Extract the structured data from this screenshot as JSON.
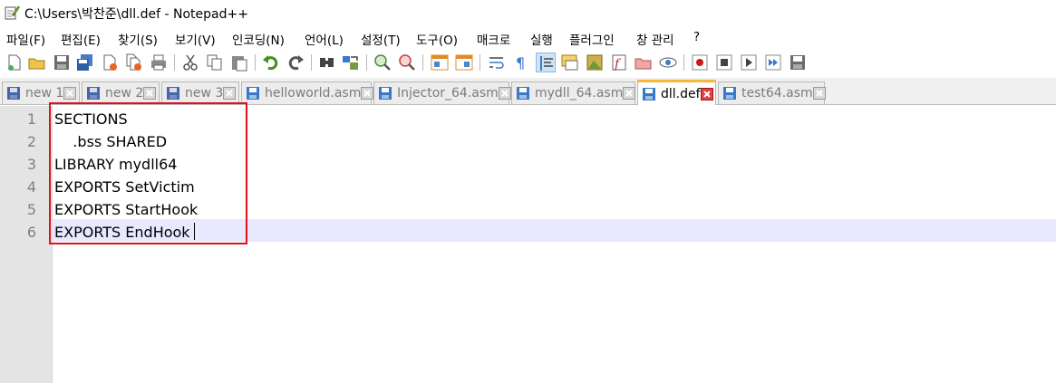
{
  "window": {
    "title": "C:\\Users\\박찬준\\dll.def - Notepad++",
    "icon": "notepadpp-icon"
  },
  "menu": {
    "items": [
      "파일(F)",
      "편집(E)",
      "찾기(S)",
      "보기(V)",
      "인코딩(N)",
      "언어(L)",
      "설정(T)",
      "도구(O)",
      "매크로",
      "실행",
      "플러그인",
      "창 관리",
      "?"
    ]
  },
  "tabs": [
    {
      "label": "new 1",
      "state": "unsaved"
    },
    {
      "label": "new 2",
      "state": "unsaved"
    },
    {
      "label": "new 3",
      "state": "unsaved"
    },
    {
      "label": "helloworld.asm",
      "state": "saved"
    },
    {
      "label": "Injector_64.asm",
      "state": "saved"
    },
    {
      "label": "mydll_64.asm",
      "state": "saved"
    },
    {
      "label": "dll.def",
      "state": "saved",
      "active": true
    },
    {
      "label": "test64.asm",
      "state": "saved"
    }
  ],
  "editor": {
    "line_numbers": [
      "1",
      "2",
      "3",
      "4",
      "5",
      "6"
    ],
    "lines": [
      "SECTIONS",
      "    .bss SHARED",
      "LIBRARY mydll64",
      "EXPORTS SetVictim",
      "EXPORTS StartHook",
      "EXPORTS EndHook"
    ],
    "current_line": 6
  },
  "colors": {
    "accent_tab": "#f7b63c",
    "highlight_box": "#e3101c",
    "gutter": "#e4e4e4",
    "current_line": "#e8e8ff"
  }
}
